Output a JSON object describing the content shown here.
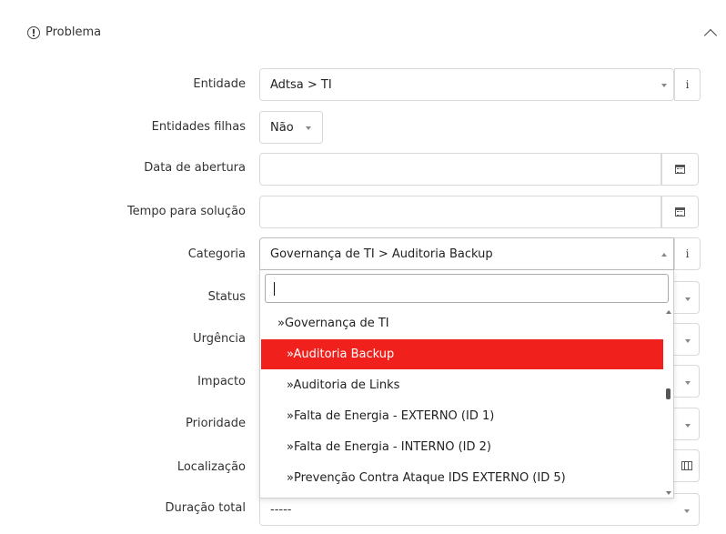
{
  "panel": {
    "title": "Problema"
  },
  "labels": {
    "entidade": "Entidade",
    "entidades_filhas": "Entidades filhas",
    "data_abertura": "Data de abertura",
    "tempo_solucao": "Tempo para solução",
    "categoria": "Categoria",
    "status": "Status",
    "urgencia": "Urgência",
    "impacto": "Impacto",
    "prioridade": "Prioridade",
    "localizacao": "Localização",
    "duracao_total": "Duração total"
  },
  "fields": {
    "entidade_value": "Adtsa > TI",
    "entidade_info": "i",
    "entidades_filhas_value": "Não",
    "data_abertura_value": "",
    "tempo_solucao_value": "",
    "categoria_value": "Governança de TI > Auditoria Backup",
    "categoria_info": "i",
    "duracao_total_value": "-----"
  },
  "dropdown": {
    "search_value": "",
    "items": [
      {
        "label": "»Governança de TI",
        "selected": false
      },
      {
        "label": "»Auditoria Backup",
        "selected": true
      },
      {
        "label": "»Auditoria de Links",
        "selected": false
      },
      {
        "label": "»Falta de Energia - EXTERNO (ID 1)",
        "selected": false
      },
      {
        "label": "»Falta de Energia - INTERNO (ID 2)",
        "selected": false
      },
      {
        "label": "»Prevenção Contra Ataque IDS EXTERNO (ID 5)",
        "selected": false
      }
    ],
    "highlight_color": "#f0211c"
  },
  "icons": {
    "panel_icon": "info-circle-icon",
    "collapse_icon": "chevron-up-icon",
    "calendar_icon": "calendar-icon",
    "map_icon": "map-icon"
  }
}
